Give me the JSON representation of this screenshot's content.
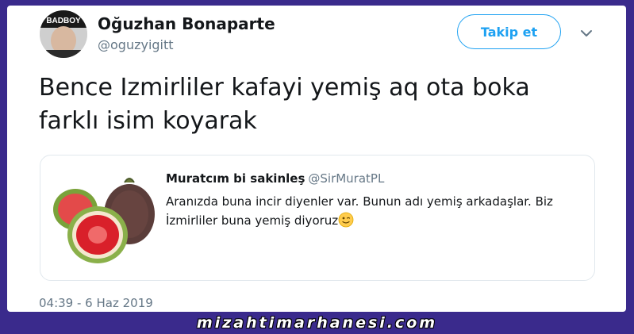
{
  "author": {
    "name": "Oğuzhan Bonaparte",
    "handle": "@oguzyigitt",
    "avatar_icon": "user-avatar"
  },
  "follow_button": {
    "label": "Takip et"
  },
  "more_icon": "chevron-down-icon",
  "tweet": {
    "text": "Bence Izmirliler kafayi yemiş aq ota boka\nfarklı isim  koyarak",
    "timestamp": "04:39 - 6 Haz 2019"
  },
  "quoted_tweet": {
    "author_name": "Muratcım bi sakinleş",
    "author_handle": "@SirMuratPL",
    "text": "Aranızda buna incir diyenler var. Bunun adı yemiş arkadaşlar. Biz\nİzmirliler buna yemiş diyoruz",
    "emoji": "winking-face-emoji",
    "image": "fig-fruit-image"
  },
  "watermark": "mizahtimarhanesi.com",
  "colors": {
    "accent": "#1da1f2",
    "background": "#3a2a8c",
    "text": "#14171a",
    "muted": "#657786"
  }
}
